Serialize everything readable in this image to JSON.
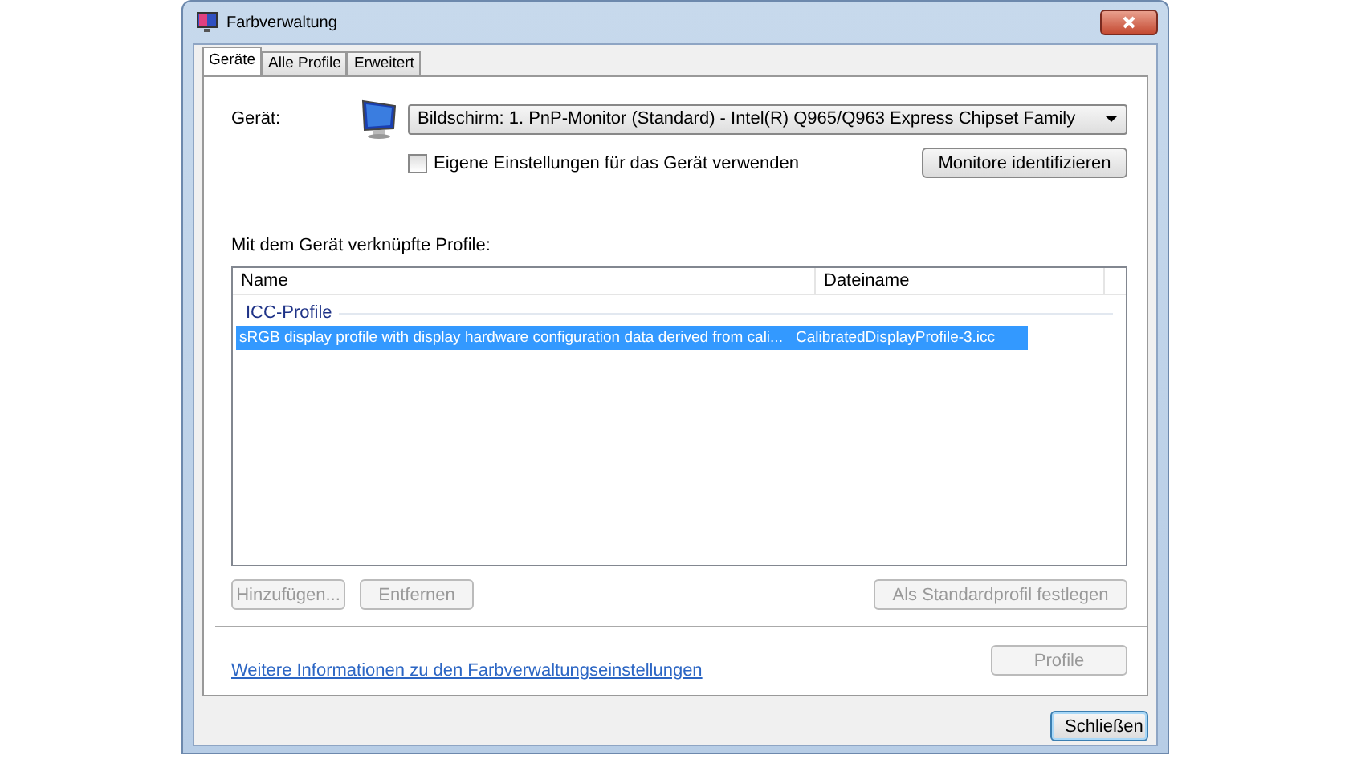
{
  "window": {
    "title": "Farbverwaltung"
  },
  "tabs": [
    {
      "label": "Geräte",
      "selected": true
    },
    {
      "label": "Alle Profile",
      "selected": false
    },
    {
      "label": "Erweitert",
      "selected": false
    }
  ],
  "device": {
    "label": "Gerät:",
    "value": "Bildschirm: 1. PnP-Monitor (Standard) - Intel(R)  Q965/Q963 Express Chipset Family",
    "custom_settings": {
      "label": "Eigene Einstellungen für das Gerät verwenden",
      "checked": false
    },
    "identify_button": {
      "label": "Monitore identifizieren",
      "disabled": false
    }
  },
  "profiles": {
    "label": "Mit dem Gerät verknüpfte Profile:",
    "columns": [
      "Name",
      "Dateiname"
    ],
    "groups": [
      {
        "title": "ICC-Profile",
        "rows": [
          {
            "name": "sRGB display profile with display hardware configuration data derived from cali...",
            "file": "CalibratedDisplayProfile-3.icc",
            "selected": true
          }
        ]
      }
    ]
  },
  "list_buttons": [
    {
      "label": "Hinzufügen...",
      "disabled": true
    },
    {
      "label": "Entfernen",
      "disabled": true
    },
    {
      "label": "Als Standardprofil festlegen",
      "disabled": true
    }
  ],
  "link": "Weitere Informationen zu den Farbverwaltungseinstellungen",
  "profile_button": {
    "label": "Profile",
    "disabled": true
  },
  "close_button": {
    "label": "Schließen",
    "disabled": false
  }
}
